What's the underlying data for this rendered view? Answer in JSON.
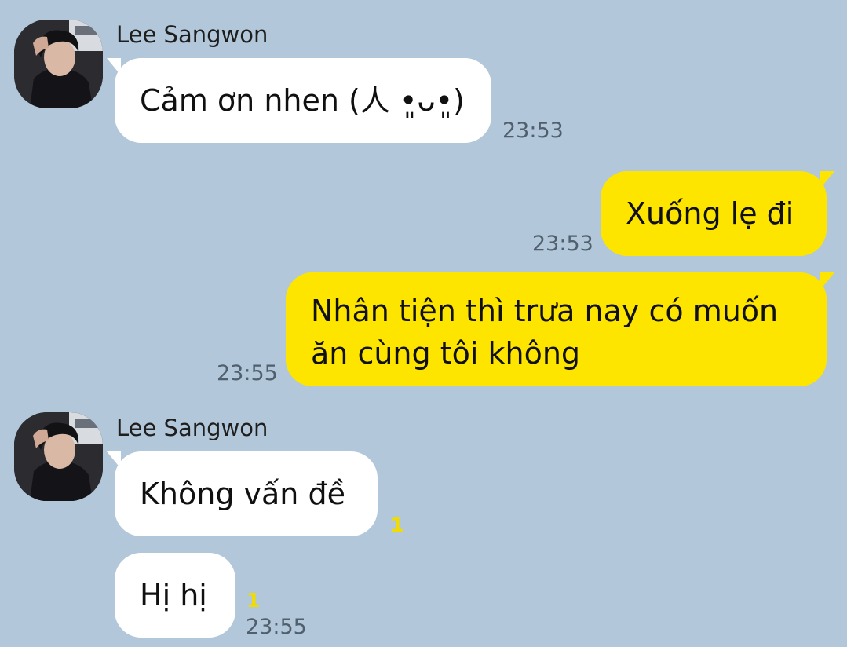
{
  "messages": [
    {
      "type": "incoming",
      "sender": "Lee Sangwon",
      "text": "Cảm ơn nhen (人 •͈ᴗ•͈)",
      "time": "23:53"
    },
    {
      "type": "outgoing",
      "text": "Xuống lẹ đi",
      "time": "23:53"
    },
    {
      "type": "outgoing",
      "text": "Nhân tiện thì trưa nay có muốn ăn cùng tôi không",
      "time": "23:55"
    },
    {
      "type": "incoming",
      "sender": "Lee Sangwon",
      "text": "Không vấn đề",
      "unread": "1"
    },
    {
      "type": "incoming",
      "text": "Hị hị",
      "unread": "1",
      "time": "23:55"
    }
  ],
  "icons": {
    "avatar": "profile-photo"
  },
  "colors": {
    "background": "#b2c7d9",
    "incoming_bubble": "#ffffff",
    "outgoing_bubble": "#fee500",
    "unread_badge": "#f2dc00",
    "timestamp": "#4f5f6d"
  }
}
